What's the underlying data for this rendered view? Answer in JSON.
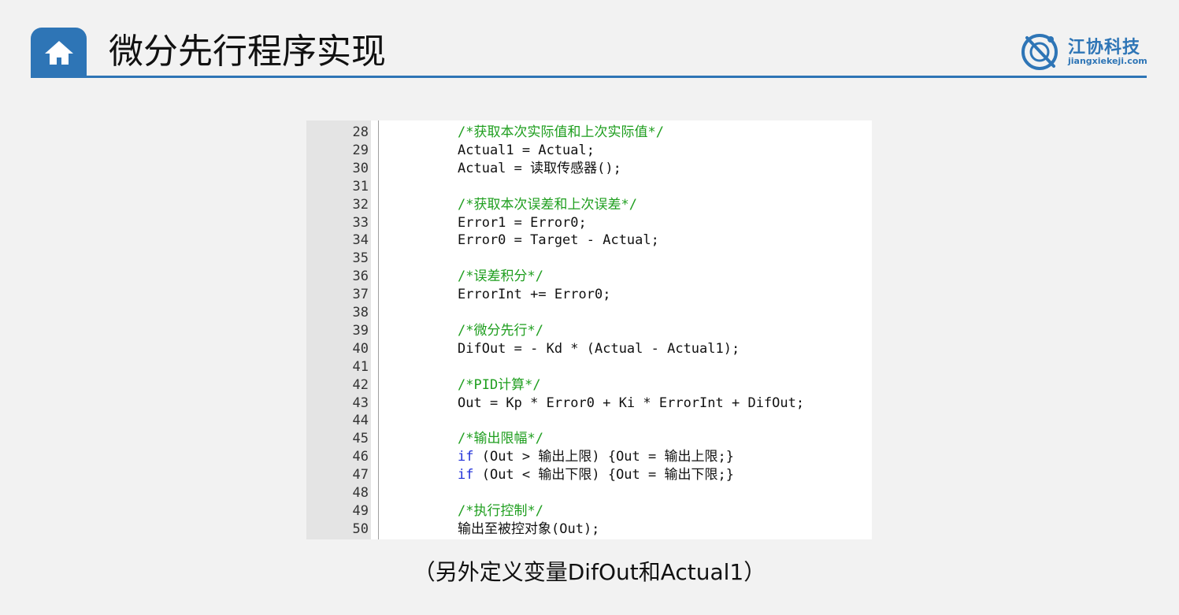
{
  "header": {
    "title": "微分先行程序实现",
    "logo_name": "江协科技",
    "logo_url": "jiangxiekeji.com",
    "accent_color": "#2e75b6",
    "home_icon": "home-icon"
  },
  "code": {
    "lines": [
      {
        "no": "28",
        "text": "/*获取本次实际值和上次实际值*/",
        "kind": "comment"
      },
      {
        "no": "29",
        "text": "Actual1 = Actual;",
        "kind": "code"
      },
      {
        "no": "30",
        "text": "Actual = 读取传感器();",
        "kind": "code"
      },
      {
        "no": "31",
        "text": "",
        "kind": "code"
      },
      {
        "no": "32",
        "text": "/*获取本次误差和上次误差*/",
        "kind": "comment"
      },
      {
        "no": "33",
        "text": "Error1 = Error0;",
        "kind": "code"
      },
      {
        "no": "34",
        "text": "Error0 = Target - Actual;",
        "kind": "code"
      },
      {
        "no": "35",
        "text": "",
        "kind": "code"
      },
      {
        "no": "36",
        "text": "/*误差积分*/",
        "kind": "comment"
      },
      {
        "no": "37",
        "text": "ErrorInt += Error0;",
        "kind": "code"
      },
      {
        "no": "38",
        "text": "",
        "kind": "code"
      },
      {
        "no": "39",
        "text": "/*微分先行*/",
        "kind": "comment"
      },
      {
        "no": "40",
        "text": "DifOut = - Kd * (Actual - Actual1);",
        "kind": "code"
      },
      {
        "no": "41",
        "text": "",
        "kind": "code"
      },
      {
        "no": "42",
        "text": "/*PID计算*/",
        "kind": "comment"
      },
      {
        "no": "43",
        "text": "Out = Kp * Error0 + Ki * ErrorInt + DifOut;",
        "kind": "code"
      },
      {
        "no": "44",
        "text": "",
        "kind": "code"
      },
      {
        "no": "45",
        "text": "/*输出限幅*/",
        "kind": "comment"
      },
      {
        "no": "46",
        "keyword": "if",
        "text": " (Out > 输出上限) {Out = 输出上限;}",
        "kind": "code"
      },
      {
        "no": "47",
        "keyword": "if",
        "text": " (Out < 输出下限) {Out = 输出下限;}",
        "kind": "code"
      },
      {
        "no": "48",
        "text": "",
        "kind": "code"
      },
      {
        "no": "49",
        "text": "/*执行控制*/",
        "kind": "comment"
      },
      {
        "no": "50",
        "text": "输出至被控对象(Out);",
        "kind": "code"
      }
    ]
  },
  "caption": "（另外定义变量DifOut和Actual1）"
}
